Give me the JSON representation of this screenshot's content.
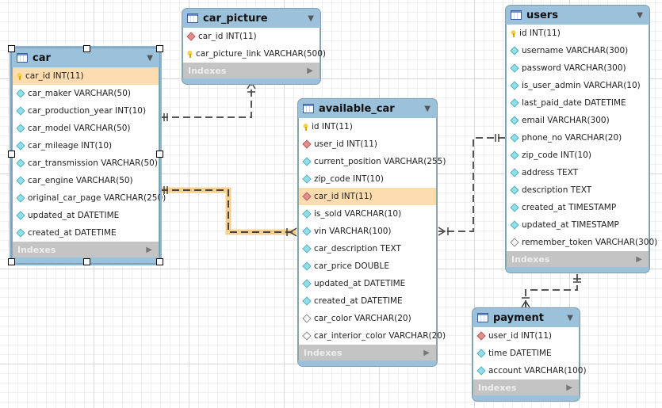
{
  "tables": {
    "car": {
      "name": "car",
      "selected": true,
      "indexes_label": "Indexes",
      "columns": [
        {
          "text": "car_id INT(11)",
          "icon": "primary-key",
          "highlight": true
        },
        {
          "text": "car_maker VARCHAR(50)",
          "icon": "not-null"
        },
        {
          "text": "car_production_year INT(10)",
          "icon": "not-null"
        },
        {
          "text": "car_model VARCHAR(50)",
          "icon": "not-null"
        },
        {
          "text": "car_mileage INT(10)",
          "icon": "not-null"
        },
        {
          "text": "car_transmission VARCHAR(50)",
          "icon": "not-null"
        },
        {
          "text": "car_engine VARCHAR(50)",
          "icon": "not-null"
        },
        {
          "text": "original_car_page VARCHAR(250)",
          "icon": "not-null"
        },
        {
          "text": "updated_at DATETIME",
          "icon": "not-null"
        },
        {
          "text": "created_at DATETIME",
          "icon": "not-null"
        }
      ]
    },
    "car_picture": {
      "name": "car_picture",
      "indexes_label": "Indexes",
      "columns": [
        {
          "text": "car_id INT(11)",
          "icon": "foreign-key"
        },
        {
          "text": "car_picture_link VARCHAR(500)",
          "icon": "primary-key"
        }
      ]
    },
    "available_car": {
      "name": "available_car",
      "indexes_label": "Indexes",
      "columns": [
        {
          "text": "id INT(11)",
          "icon": "primary-key"
        },
        {
          "text": "user_id INT(11)",
          "icon": "foreign-key"
        },
        {
          "text": "current_position VARCHAR(255)",
          "icon": "not-null"
        },
        {
          "text": "zip_code INT(10)",
          "icon": "not-null"
        },
        {
          "text": "car_id INT(11)",
          "icon": "foreign-key",
          "highlight": true
        },
        {
          "text": "is_sold VARCHAR(10)",
          "icon": "not-null"
        },
        {
          "text": "vin VARCHAR(100)",
          "icon": "not-null"
        },
        {
          "text": "car_description TEXT",
          "icon": "not-null"
        },
        {
          "text": "car_price DOUBLE",
          "icon": "not-null"
        },
        {
          "text": "updated_at DATETIME",
          "icon": "not-null"
        },
        {
          "text": "created_at DATETIME",
          "icon": "not-null"
        },
        {
          "text": "car_color VARCHAR(20)",
          "icon": "nullable"
        },
        {
          "text": "car_interior_color VARCHAR(20)",
          "icon": "nullable"
        }
      ]
    },
    "users": {
      "name": "users",
      "indexes_label": "Indexes",
      "columns": [
        {
          "text": "id INT(11)",
          "icon": "primary-key"
        },
        {
          "text": "username VARCHAR(300)",
          "icon": "not-null"
        },
        {
          "text": "password VARCHAR(300)",
          "icon": "not-null"
        },
        {
          "text": "is_user_admin VARCHAR(10)",
          "icon": "not-null"
        },
        {
          "text": "last_paid_date DATETIME",
          "icon": "not-null"
        },
        {
          "text": "email VARCHAR(300)",
          "icon": "not-null"
        },
        {
          "text": "phone_no VARCHAR(20)",
          "icon": "not-null"
        },
        {
          "text": "zip_code INT(10)",
          "icon": "not-null"
        },
        {
          "text": "address TEXT",
          "icon": "not-null"
        },
        {
          "text": "description TEXT",
          "icon": "not-null"
        },
        {
          "text": "created_at TIMESTAMP",
          "icon": "not-null"
        },
        {
          "text": "updated_at TIMESTAMP",
          "icon": "not-null"
        },
        {
          "text": "remember_token VARCHAR(300)",
          "icon": "nullable"
        }
      ]
    },
    "payment": {
      "name": "payment",
      "indexes_label": "Indexes",
      "columns": [
        {
          "text": "user_id INT(11)",
          "icon": "foreign-key"
        },
        {
          "text": "time DATETIME",
          "icon": "not-null"
        },
        {
          "text": "account VARCHAR(100)",
          "icon": "not-null"
        }
      ]
    }
  },
  "relationships": [
    {
      "from": "car",
      "to": "car_picture"
    },
    {
      "from": "car",
      "to": "available_car",
      "highlight": true,
      "highlight_color": "#f5b342"
    },
    {
      "from": "users",
      "to": "available_car"
    },
    {
      "from": "users",
      "to": "payment"
    }
  ]
}
